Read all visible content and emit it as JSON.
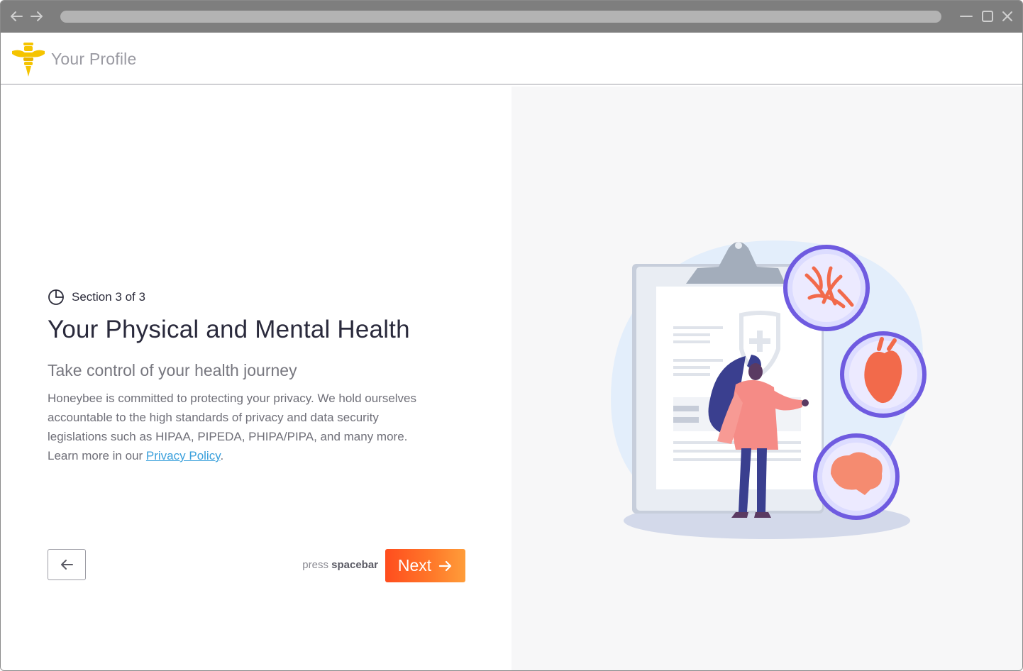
{
  "window": {
    "nav_back_icon": "arrow-left-icon",
    "nav_forward_icon": "arrow-right-icon"
  },
  "header": {
    "title": "Your Profile",
    "logo_icon": "honeybee-logo"
  },
  "intro": {
    "section_label": "Section 3 of 3",
    "section_icon": "pie-progress-icon",
    "heading": "Your Physical and Mental Health",
    "subheading": "Take control of your health journey",
    "body_lines": [
      "Honeybee is committed to protecting your privacy. We hold ourselves",
      "accountable to the high standards of privacy and data security",
      "legislations such as HIPAA, PIPEDA, PHIPA/PIPA, and many more."
    ],
    "learn_more_prefix": "Learn more in our ",
    "privacy_link": "Privacy Policy",
    "learn_more_suffix": "."
  },
  "footer": {
    "hint_prefix": "press ",
    "hint_key": "spacebar",
    "next_label": "Next",
    "back_icon": "arrow-left-icon",
    "next_icon": "arrow-right-icon"
  },
  "colors": {
    "accent_start": "#ff4d1e",
    "accent_end": "#ff9d3a",
    "link": "#3aa0dc",
    "logo_yellow": "#f5c400",
    "circle_border": "#6f5be0"
  }
}
